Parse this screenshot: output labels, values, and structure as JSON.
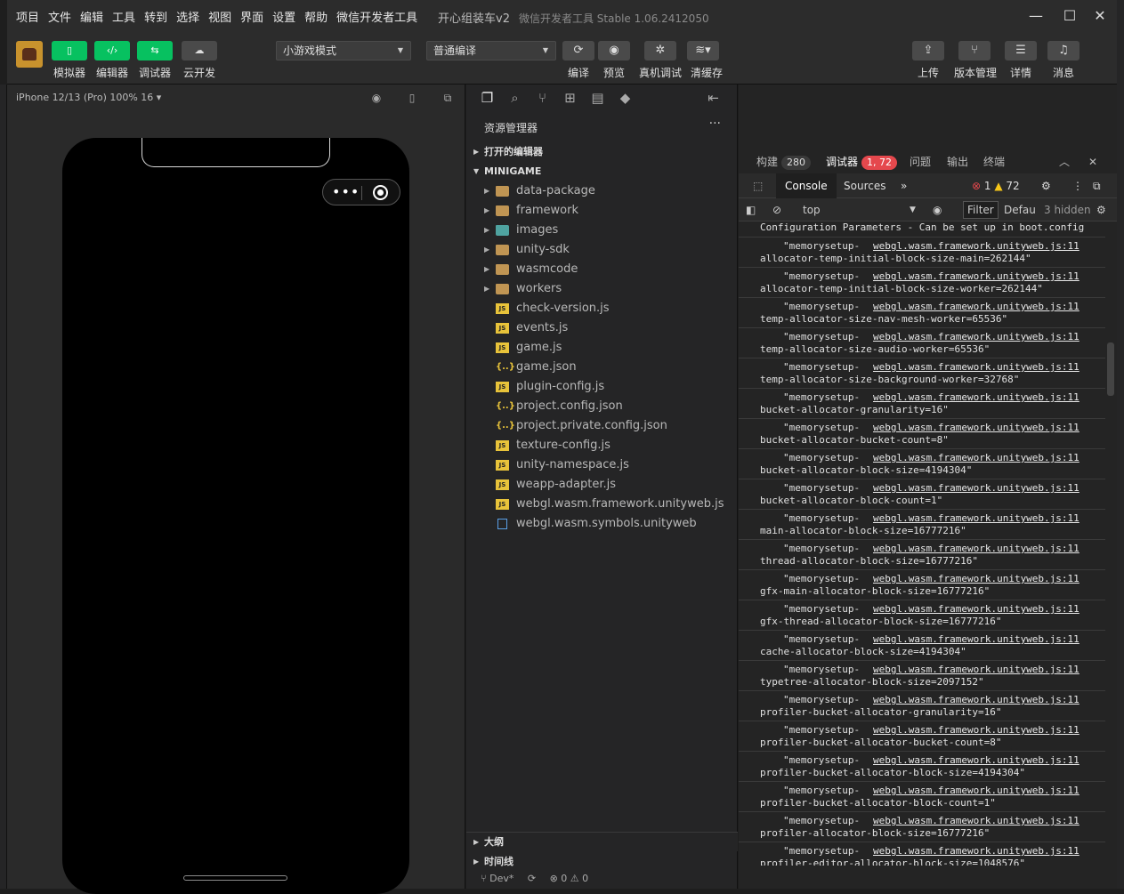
{
  "menu": [
    "项目",
    "文件",
    "编辑",
    "工具",
    "转到",
    "选择",
    "视图",
    "界面",
    "设置",
    "帮助",
    "微信开发者工具"
  ],
  "window": {
    "title": "开心组装车v2",
    "subtitle": "微信开发者工具 Stable 1.06.2412050"
  },
  "toolbar": {
    "simulator": "模拟器",
    "editor": "编辑器",
    "debugger": "调试器",
    "cloud": "云开发",
    "mode_select": "小游戏模式",
    "compile_select": "普通编译",
    "compile": "编译",
    "preview": "预览",
    "real_debug": "真机调试",
    "clear_cache": "清缓存",
    "upload": "上传",
    "version": "版本管理",
    "detail": "详情",
    "message": "消息"
  },
  "simulator": {
    "device": "iPhone 12/13 (Pro) 100% 16 ▾"
  },
  "explorer": {
    "title": "资源管理器",
    "open_editors": "打开的编辑器",
    "project": "MINIGAME",
    "folders": [
      "data-package",
      "framework",
      "images",
      "unity-sdk",
      "wasmcode",
      "workers"
    ],
    "files": [
      {
        "name": "check-version.js",
        "type": "js"
      },
      {
        "name": "events.js",
        "type": "js"
      },
      {
        "name": "game.js",
        "type": "js"
      },
      {
        "name": "game.json",
        "type": "json"
      },
      {
        "name": "plugin-config.js",
        "type": "js"
      },
      {
        "name": "project.config.json",
        "type": "json"
      },
      {
        "name": "project.private.config.json",
        "type": "json"
      },
      {
        "name": "texture-config.js",
        "type": "js"
      },
      {
        "name": "unity-namespace.js",
        "type": "js"
      },
      {
        "name": "weapp-adapter.js",
        "type": "js"
      },
      {
        "name": "webgl.wasm.framework.unityweb.js",
        "type": "js"
      },
      {
        "name": "webgl.wasm.symbols.unityweb",
        "type": "file"
      }
    ],
    "outline": "大纲",
    "timeline": "时间线",
    "status_branch": "Dev*",
    "status_problems": "0",
    "status_warnings": "0"
  },
  "debug": {
    "tab_build": "构建",
    "build_count": "280",
    "tab_debugger": "调试器",
    "debugger_count": "1, 72",
    "tab_problems": "问题",
    "tab_output": "输出",
    "tab_terminal": "终端",
    "console_tab": "Console",
    "sources_tab": "Sources",
    "errors": "1",
    "warnings": "72",
    "context": "top",
    "filter": "Filter",
    "levels": "Defau",
    "hidden": "3 hidden",
    "first_line": "Configuration Parameters - Can be set up in boot.config",
    "source_link": "webgl.wasm.framework.unityweb.js:11",
    "entries": [
      "allocator-temp-initial-block-size-main=262144\"",
      "allocator-temp-initial-block-size-worker=262144\"",
      "temp-allocator-size-nav-mesh-worker=65536\"",
      "temp-allocator-size-audio-worker=65536\"",
      "temp-allocator-size-background-worker=32768\"",
      "bucket-allocator-granularity=16\"",
      "bucket-allocator-bucket-count=8\"",
      "bucket-allocator-block-size=4194304\"",
      "bucket-allocator-block-count=1\"",
      "main-allocator-block-size=16777216\"",
      "thread-allocator-block-size=16777216\"",
      "gfx-main-allocator-block-size=16777216\"",
      "gfx-thread-allocator-block-size=16777216\"",
      "cache-allocator-block-size=4194304\"",
      "typetree-allocator-block-size=2097152\"",
      "profiler-bucket-allocator-granularity=16\"",
      "profiler-bucket-allocator-bucket-count=8\"",
      "profiler-bucket-allocator-block-size=4194304\"",
      "profiler-bucket-allocator-block-count=1\"",
      "profiler-allocator-block-size=16777216\"",
      "profiler-editor-allocator-block-size=1048576\""
    ],
    "entry_prefix": "\"memorysetup-"
  }
}
